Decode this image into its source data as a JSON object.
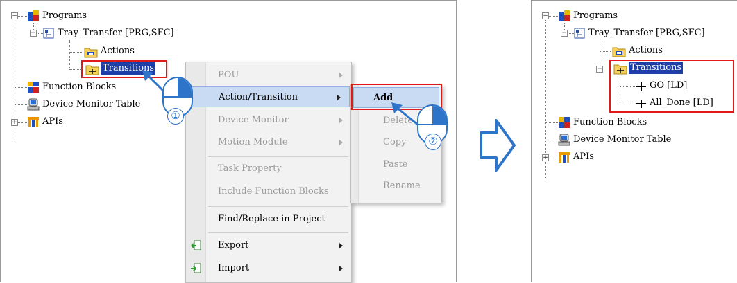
{
  "left_tree": {
    "programs": "Programs",
    "tray_transfer": "Tray_Transfer [PRG,SFC]",
    "actions": "Actions",
    "transitions": "Transitions",
    "function_blocks": "Function Blocks",
    "device_monitor_table": "Device Monitor Table",
    "apis": "APIs"
  },
  "context_menu": {
    "items": [
      {
        "label": "POU",
        "enabled": false,
        "submenu": true
      },
      {
        "label": "Action/Transition",
        "enabled": true,
        "submenu": true,
        "highlighted": true
      },
      {
        "label": "Device Monitor",
        "enabled": false,
        "submenu": true
      },
      {
        "label": "Motion Module",
        "enabled": false,
        "submenu": true
      },
      {
        "label": "Task Property",
        "enabled": false,
        "submenu": false
      },
      {
        "label": "Include Function Blocks",
        "enabled": false,
        "submenu": false
      },
      {
        "label": "Find/Replace in Project",
        "enabled": true,
        "submenu": false
      },
      {
        "label": "Export",
        "enabled": true,
        "submenu": true
      },
      {
        "label": "Import",
        "enabled": true,
        "submenu": true
      }
    ]
  },
  "submenu": {
    "items": [
      {
        "label": "Add",
        "enabled": true,
        "highlighted": true
      },
      {
        "label": "Delete",
        "enabled": false
      },
      {
        "label": "Copy",
        "enabled": false
      },
      {
        "label": "Paste",
        "enabled": false
      },
      {
        "label": "Rename",
        "enabled": false
      }
    ]
  },
  "steps": {
    "step1": "①",
    "step2": "②"
  },
  "right_tree": {
    "programs": "Programs",
    "tray_transfer": "Tray_Transfer [PRG,SFC]",
    "actions": "Actions",
    "transitions": "Transitions",
    "go": "GO [LD]",
    "all_done": "All_Done [LD]",
    "function_blocks": "Function Blocks",
    "device_monitor_table": "Device Monitor Table",
    "apis": "APIs"
  },
  "colors": {
    "highlight_box": "#e01a1a",
    "arrow": "#2e74c9",
    "selection": "#1f3fa8"
  }
}
